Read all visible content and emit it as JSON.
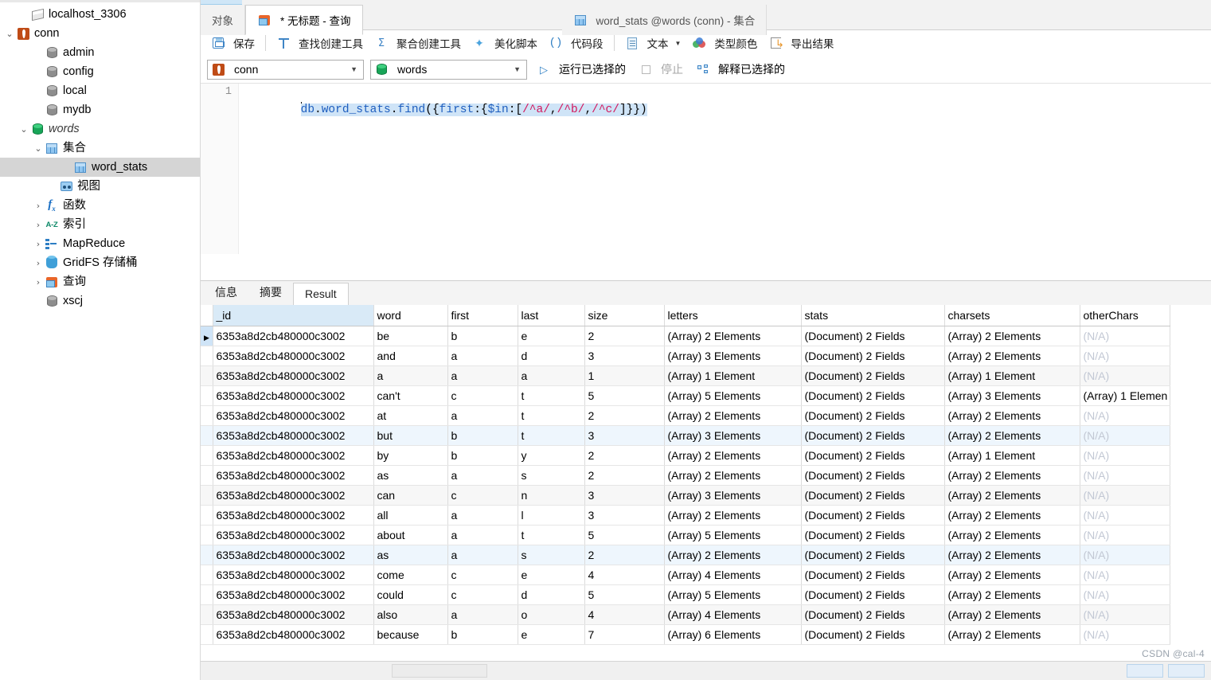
{
  "sidebar": {
    "items": [
      {
        "label": "localhost_3306",
        "icon": "server-icon",
        "indent": 1,
        "twisty": "",
        "selected": false,
        "italic": false
      },
      {
        "label": "conn",
        "icon": "mongo-leaf-icon",
        "indent": 0,
        "twisty": "v",
        "selected": false,
        "italic": false
      },
      {
        "label": "admin",
        "icon": "database-icon",
        "indent": 2,
        "twisty": "",
        "selected": false,
        "italic": false
      },
      {
        "label": "config",
        "icon": "database-icon",
        "indent": 2,
        "twisty": "",
        "selected": false,
        "italic": false
      },
      {
        "label": "local",
        "icon": "database-icon",
        "indent": 2,
        "twisty": "",
        "selected": false,
        "italic": false
      },
      {
        "label": "mydb",
        "icon": "database-icon",
        "indent": 2,
        "twisty": "",
        "selected": false,
        "italic": false
      },
      {
        "label": "words",
        "icon": "database-green-icon",
        "indent": 1,
        "twisty": "v",
        "selected": false,
        "italic": true
      },
      {
        "label": "集合",
        "icon": "collection-icon",
        "indent": 2,
        "twisty": "v",
        "selected": false,
        "italic": false
      },
      {
        "label": "word_stats",
        "icon": "collection-icon",
        "indent": 4,
        "twisty": "",
        "selected": true,
        "italic": false
      },
      {
        "label": "视图",
        "icon": "view-icon",
        "indent": 3,
        "twisty": "",
        "selected": false,
        "italic": false
      },
      {
        "label": "函数",
        "icon": "function-icon",
        "indent": 2,
        "twisty": ">",
        "selected": false,
        "italic": false
      },
      {
        "label": "索引",
        "icon": "index-az-icon",
        "indent": 2,
        "twisty": ">",
        "selected": false,
        "italic": false
      },
      {
        "label": "MapReduce",
        "icon": "mapreduce-icon",
        "indent": 2,
        "twisty": ">",
        "selected": false,
        "italic": false
      },
      {
        "label": "GridFS 存储桶",
        "icon": "gridfs-icon",
        "indent": 2,
        "twisty": ">",
        "selected": false,
        "italic": false
      },
      {
        "label": "查询",
        "icon": "query-icon",
        "indent": 2,
        "twisty": ">",
        "selected": false,
        "italic": false
      },
      {
        "label": "xscj",
        "icon": "database-icon",
        "indent": 2,
        "twisty": "",
        "selected": false,
        "italic": false
      }
    ]
  },
  "tabs": {
    "objects": "对象",
    "query_tab": "* 无标题 - 查询",
    "collection_tab": "word_stats @words (conn) - 集合"
  },
  "toolbar": {
    "save": "保存",
    "find_builder": "查找创建工具",
    "aggregate_builder": "聚合创建工具",
    "beautify": "美化脚本",
    "snippet": "代码段",
    "text": "文本",
    "type_color": "类型颜色",
    "export_result": "导出结果"
  },
  "runbar": {
    "connection": "conn",
    "database": "words",
    "run_selected": "运行已选择的",
    "stop": "停止",
    "explain_selected": "解释已选择的"
  },
  "editor": {
    "line_number": "1",
    "code_tokens": [
      {
        "t": "db",
        "c": "blue"
      },
      {
        "t": ".",
        "c": "black"
      },
      {
        "t": "word_stats",
        "c": "blue"
      },
      {
        "t": ".",
        "c": "black"
      },
      {
        "t": "find",
        "c": "blue"
      },
      {
        "t": "({",
        "c": "black"
      },
      {
        "t": "first",
        "c": "blue"
      },
      {
        "t": ":{",
        "c": "black"
      },
      {
        "t": "$in",
        "c": "blue"
      },
      {
        "t": ":[",
        "c": "black"
      },
      {
        "t": "/^a/",
        "c": "re"
      },
      {
        "t": ",",
        "c": "black"
      },
      {
        "t": "/^b/",
        "c": "re"
      },
      {
        "t": ",",
        "c": "black"
      },
      {
        "t": "/^c/",
        "c": "re"
      },
      {
        "t": "]}})",
        "c": "black"
      }
    ],
    "code_plain": "db.word_stats.find({first:{$in:[/^a/,/^b/,/^c/]}})"
  },
  "result_tabs": [
    {
      "label": "信息",
      "active": false
    },
    {
      "label": "摘要",
      "active": false
    },
    {
      "label": "Result",
      "active": true
    }
  ],
  "grid": {
    "columns": [
      "_id",
      "word",
      "first",
      "last",
      "size",
      "letters",
      "stats",
      "charsets",
      "otherChars"
    ],
    "rows": [
      {
        "_id": "6353a8d2cb480000c3002",
        "word": "be",
        "first": "b",
        "last": "e",
        "size": "2",
        "letters": "(Array) 2 Elements",
        "stats": "(Document) 2 Fields",
        "charsets": "(Array) 2 Elements",
        "otherChars": "(N/A)",
        "style": "marked"
      },
      {
        "_id": "6353a8d2cb480000c3002",
        "word": "and",
        "first": "a",
        "last": "d",
        "size": "3",
        "letters": "(Array) 3 Elements",
        "stats": "(Document) 2 Fields",
        "charsets": "(Array) 2 Elements",
        "otherChars": "(N/A)",
        "style": "normal"
      },
      {
        "_id": "6353a8d2cb480000c3002",
        "word": "a",
        "first": "a",
        "last": "a",
        "size": "1",
        "letters": "(Array) 1 Element",
        "stats": "(Document) 2 Fields",
        "charsets": "(Array) 1 Element",
        "otherChars": "(N/A)",
        "style": "alt"
      },
      {
        "_id": "6353a8d2cb480000c3002",
        "word": "can't",
        "first": "c",
        "last": "t",
        "size": "5",
        "letters": "(Array) 5 Elements",
        "stats": "(Document) 2 Fields",
        "charsets": "(Array) 3 Elements",
        "otherChars": "(Array) 1 Elemen",
        "style": "normal"
      },
      {
        "_id": "6353a8d2cb480000c3002",
        "word": "at",
        "first": "a",
        "last": "t",
        "size": "2",
        "letters": "(Array) 2 Elements",
        "stats": "(Document) 2 Fields",
        "charsets": "(Array) 2 Elements",
        "otherChars": "(N/A)",
        "style": "normal"
      },
      {
        "_id": "6353a8d2cb480000c3002",
        "word": "but",
        "first": "b",
        "last": "t",
        "size": "3",
        "letters": "(Array) 3 Elements",
        "stats": "(Document) 2 Fields",
        "charsets": "(Array) 2 Elements",
        "otherChars": "(N/A)",
        "style": "hl"
      },
      {
        "_id": "6353a8d2cb480000c3002",
        "word": "by",
        "first": "b",
        "last": "y",
        "size": "2",
        "letters": "(Array) 2 Elements",
        "stats": "(Document) 2 Fields",
        "charsets": "(Array) 1 Element",
        "otherChars": "(N/A)",
        "style": "normal"
      },
      {
        "_id": "6353a8d2cb480000c3002",
        "word": "as",
        "first": "a",
        "last": "s",
        "size": "2",
        "letters": "(Array) 2 Elements",
        "stats": "(Document) 2 Fields",
        "charsets": "(Array) 2 Elements",
        "otherChars": "(N/A)",
        "style": "normal"
      },
      {
        "_id": "6353a8d2cb480000c3002",
        "word": "can",
        "first": "c",
        "last": "n",
        "size": "3",
        "letters": "(Array) 3 Elements",
        "stats": "(Document) 2 Fields",
        "charsets": "(Array) 2 Elements",
        "otherChars": "(N/A)",
        "style": "alt"
      },
      {
        "_id": "6353a8d2cb480000c3002",
        "word": "all",
        "first": "a",
        "last": "l",
        "size": "3",
        "letters": "(Array) 2 Elements",
        "stats": "(Document) 2 Fields",
        "charsets": "(Array) 2 Elements",
        "otherChars": "(N/A)",
        "style": "normal"
      },
      {
        "_id": "6353a8d2cb480000c3002",
        "word": "about",
        "first": "a",
        "last": "t",
        "size": "5",
        "letters": "(Array) 5 Elements",
        "stats": "(Document) 2 Fields",
        "charsets": "(Array) 2 Elements",
        "otherChars": "(N/A)",
        "style": "normal"
      },
      {
        "_id": "6353a8d2cb480000c3002",
        "word": "as",
        "first": "a",
        "last": "s",
        "size": "2",
        "letters": "(Array) 2 Elements",
        "stats": "(Document) 2 Fields",
        "charsets": "(Array) 2 Elements",
        "otherChars": "(N/A)",
        "style": "hl"
      },
      {
        "_id": "6353a8d2cb480000c3002",
        "word": "come",
        "first": "c",
        "last": "e",
        "size": "4",
        "letters": "(Array) 4 Elements",
        "stats": "(Document) 2 Fields",
        "charsets": "(Array) 2 Elements",
        "otherChars": "(N/A)",
        "style": "normal"
      },
      {
        "_id": "6353a8d2cb480000c3002",
        "word": "could",
        "first": "c",
        "last": "d",
        "size": "5",
        "letters": "(Array) 5 Elements",
        "stats": "(Document) 2 Fields",
        "charsets": "(Array) 2 Elements",
        "otherChars": "(N/A)",
        "style": "normal"
      },
      {
        "_id": "6353a8d2cb480000c3002",
        "word": "also",
        "first": "a",
        "last": "o",
        "size": "4",
        "letters": "(Array) 4 Elements",
        "stats": "(Document) 2 Fields",
        "charsets": "(Array) 2 Elements",
        "otherChars": "(N/A)",
        "style": "alt"
      },
      {
        "_id": "6353a8d2cb480000c3002",
        "word": "because",
        "first": "b",
        "last": "e",
        "size": "7",
        "letters": "(Array) 6 Elements",
        "stats": "(Document) 2 Fields",
        "charsets": "(Array) 2 Elements",
        "otherChars": "(N/A)",
        "style": "normal"
      }
    ]
  },
  "watermark": "CSDN @cal-4",
  "colors": {
    "accent_blue": "#2f7fc4",
    "selection": "#cfe4f7",
    "mongo_orange": "#bf4b16",
    "db_green": "#18a558",
    "regex_red": "#d3175c"
  }
}
